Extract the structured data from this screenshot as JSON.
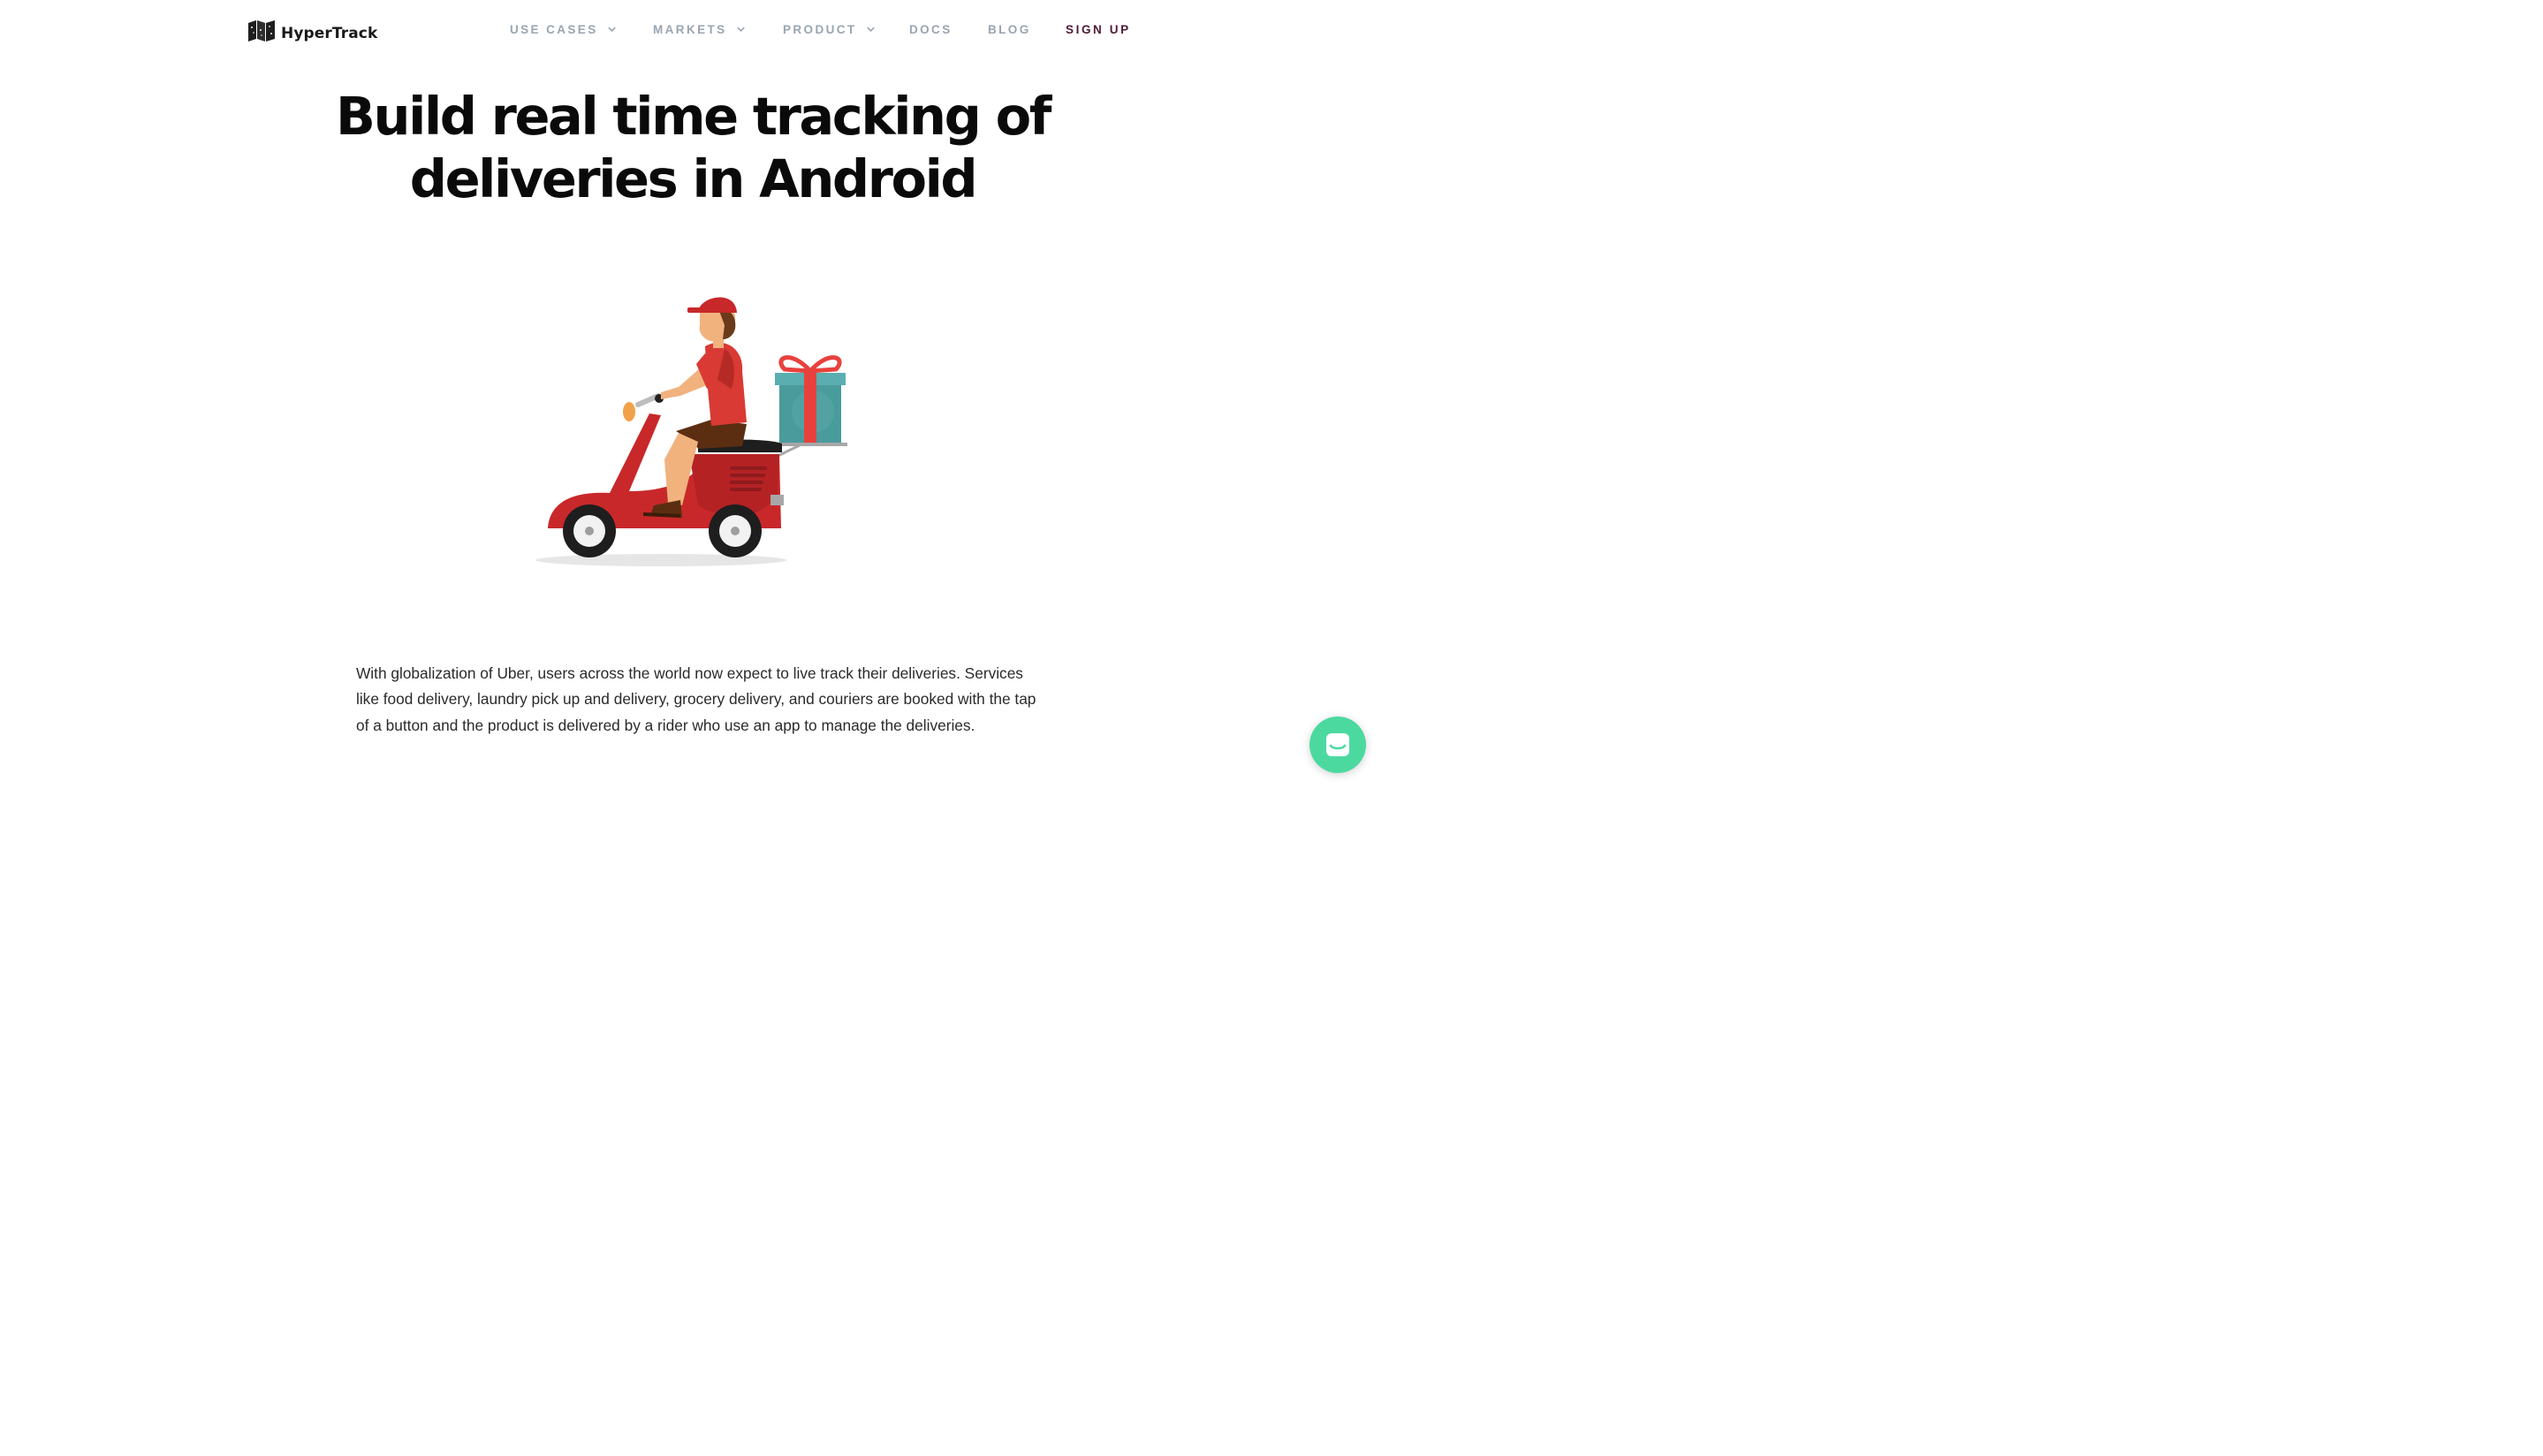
{
  "brand": {
    "name": "HyperTrack",
    "logo_icon": "folded-map-icon"
  },
  "nav": {
    "items": [
      {
        "label": "USE CASES",
        "has_dropdown": true
      },
      {
        "label": "MARKETS",
        "has_dropdown": true
      },
      {
        "label": "PRODUCT",
        "has_dropdown": true
      },
      {
        "label": "DOCS",
        "has_dropdown": false
      },
      {
        "label": "BLOG",
        "has_dropdown": false
      }
    ],
    "signup_label": "SIGN UP"
  },
  "hero": {
    "title_line1": "Build real time tracking of",
    "title_line2": "deliveries in Android",
    "illustration": "delivery-scooter-rider-with-gift-box"
  },
  "intro": {
    "text": "With globalization of Uber, users across the world now expect to live track their deliveries. Services like food delivery, laundry pick up and delivery, grocery delivery, and couriers are booked with the tap of a button and the product is delivered by a rider who use an app to manage the deliveries."
  },
  "chat": {
    "icon": "chat-bubble-icon"
  },
  "colors": {
    "nav_text": "#9aa5b1",
    "signup": "#4d1a35",
    "chat_button": "#4cd9a0",
    "scooter_red": "#c8282a",
    "gift_teal": "#4a9b9c"
  }
}
